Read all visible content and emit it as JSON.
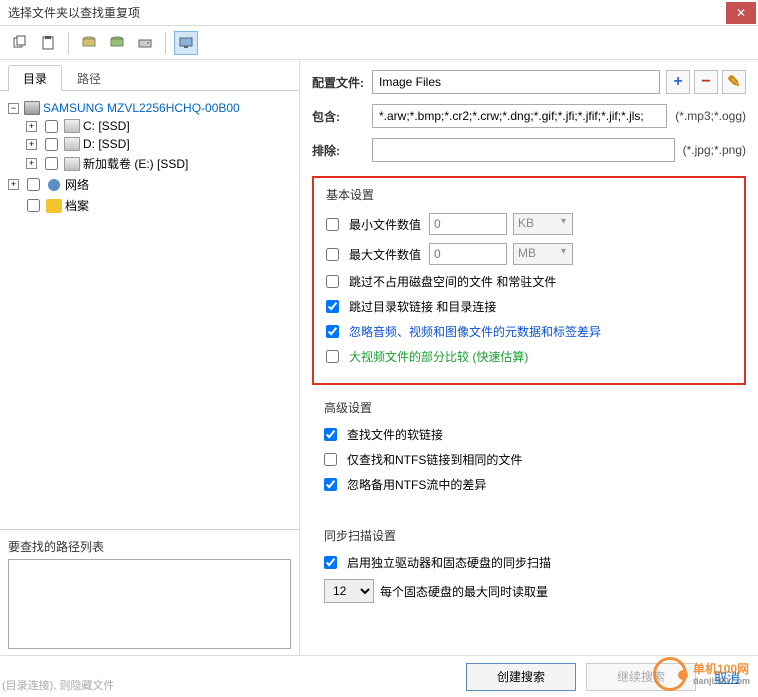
{
  "window": {
    "title": "选择文件夹以查找重复项"
  },
  "tabs": {
    "directory": "目录",
    "path": "路径"
  },
  "tree": {
    "root_label": "SAMSUNG MZVL2256HCHQ-00B00",
    "drive_c": "C: [SSD]",
    "drive_d": "D: [SSD]",
    "drive_e": "新加载卷 (E:) [SSD]",
    "network": "网络",
    "archive": "档案"
  },
  "path_list": {
    "label": "要查找的路径列表"
  },
  "config": {
    "profile_label": "配置文件:",
    "profile_value": "Image Files",
    "include_label": "包含:",
    "include_value": "*.arw;*.bmp;*.cr2;*.crw;*.dng;*.gif;*.jfi;*.jfif;*.jif;*.jls;",
    "include_suffix": "(*.mp3;*.ogg)",
    "exclude_label": "排除:",
    "exclude_value": "",
    "exclude_suffix": "(*.jpg;*.png)"
  },
  "basic": {
    "title": "基本设置",
    "min_label": "最小文件数值",
    "min_placeholder": "0",
    "min_unit": "KB",
    "max_label": "最大文件数值",
    "max_placeholder": "0",
    "max_unit": "MB",
    "skip_zero": "跳过不占用磁盘空间的文件 和常驻文件",
    "skip_symlinks": "跳过目录软链接 和目录连接",
    "ignore_meta": "忽略音频、视频和图像文件的元数据和标签差异",
    "partial_compare": "大视频文件的部分比较 (快速估算)"
  },
  "advanced": {
    "title": "高级设置",
    "find_symlinks": "查找文件的软链接",
    "ntfs_same": "仅查找和NTFS链接到相同的文件",
    "ignore_ntfs": "忽略备用NTFS流中的差异"
  },
  "sync": {
    "title": "同步扫描设置",
    "enable": "启用独立驱动器和固态硬盘的同步扫描",
    "concurrency": "12",
    "concurrency_label": "每个固态硬盘的最大同时读取量"
  },
  "footer": {
    "create": "创建搜索",
    "continue": "继续搜索",
    "cancel": "取消"
  },
  "hint": "(目录连接), 则隐藏文件",
  "watermark": {
    "line1": "单机100网",
    "line2": "danji100.com"
  }
}
